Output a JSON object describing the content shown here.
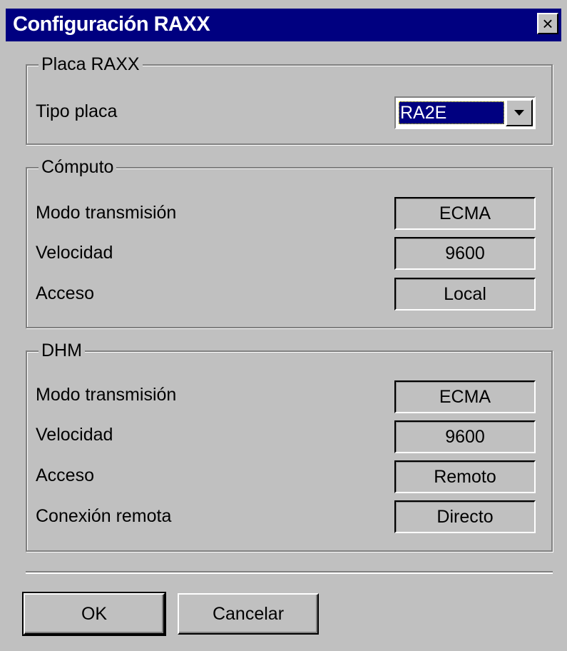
{
  "window": {
    "title": "Configuración RAXX",
    "close_glyph": "×"
  },
  "placa": {
    "group_title": "Placa RAXX",
    "tipo_label": "Tipo placa",
    "tipo_value": "RA2E"
  },
  "computo": {
    "group_title": "Cómputo",
    "rows": [
      {
        "label": "Modo transmisión",
        "value": "ECMA"
      },
      {
        "label": "Velocidad",
        "value": "9600"
      },
      {
        "label": "Acceso",
        "value": "Local"
      }
    ]
  },
  "dhm": {
    "group_title": "DHM",
    "rows": [
      {
        "label": "Modo transmisión",
        "value": "ECMA"
      },
      {
        "label": "Velocidad",
        "value": "9600"
      },
      {
        "label": "Acceso",
        "value": "Remoto"
      },
      {
        "label": "Conexión remota",
        "value": "Directo"
      }
    ]
  },
  "buttons": {
    "ok": "OK",
    "cancel": "Cancelar"
  },
  "colors": {
    "titlebar": "#000080",
    "face": "#c0c0c0",
    "selection": "#000080"
  },
  "icons": {
    "close": "close-icon",
    "dropdown": "chevron-down-icon"
  }
}
